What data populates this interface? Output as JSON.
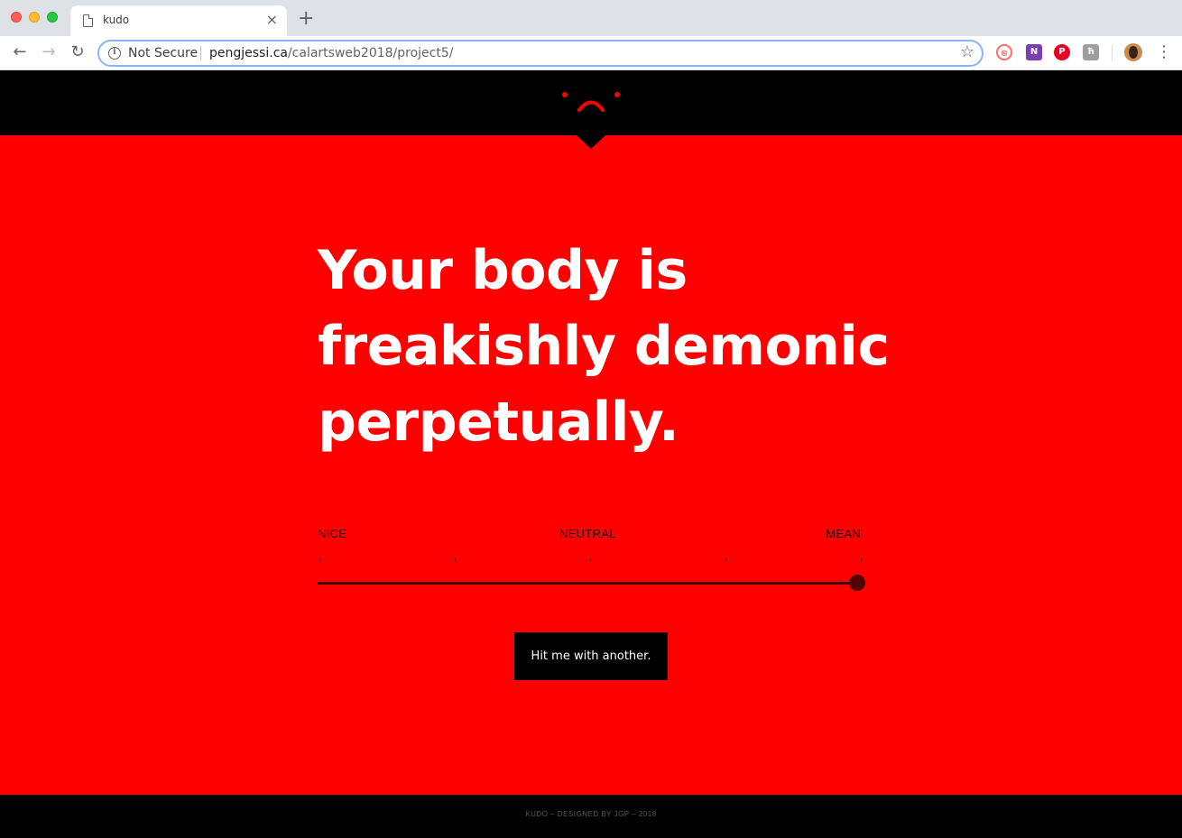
{
  "browser": {
    "tab_title": "kudo",
    "tab_close": "×",
    "new_tab": "+",
    "security_label": "Not Secure",
    "url_host": "pengjessi.ca",
    "url_path": "/calartsweb2018/project5/",
    "icons": {
      "back": "back-arrow-icon",
      "forward": "forward-arrow-icon",
      "reload": "reload-icon",
      "info": "info-icon",
      "bookmark": "star-icon",
      "menu": "kebab-menu-icon"
    },
    "extensions": [
      "toggl-extension-icon",
      "onenote-extension-icon",
      "pinterest-extension-icon",
      "extension-icon"
    ]
  },
  "site": {
    "brand_color": "#ff0000",
    "header_color": "#000000",
    "headline": {
      "line1": "Your body is",
      "line2": "freakishly demonic",
      "line3": "perpetually."
    },
    "scale": {
      "left_label": "NICE",
      "middle_label": "NEUTRAL",
      "right_label": "MEAN",
      "value_fraction": 1.0,
      "tick_count": 5
    },
    "cta_label": "Hit me with another.",
    "footer_text": "KUDO – DESIGNED BY JGP – 2018"
  }
}
